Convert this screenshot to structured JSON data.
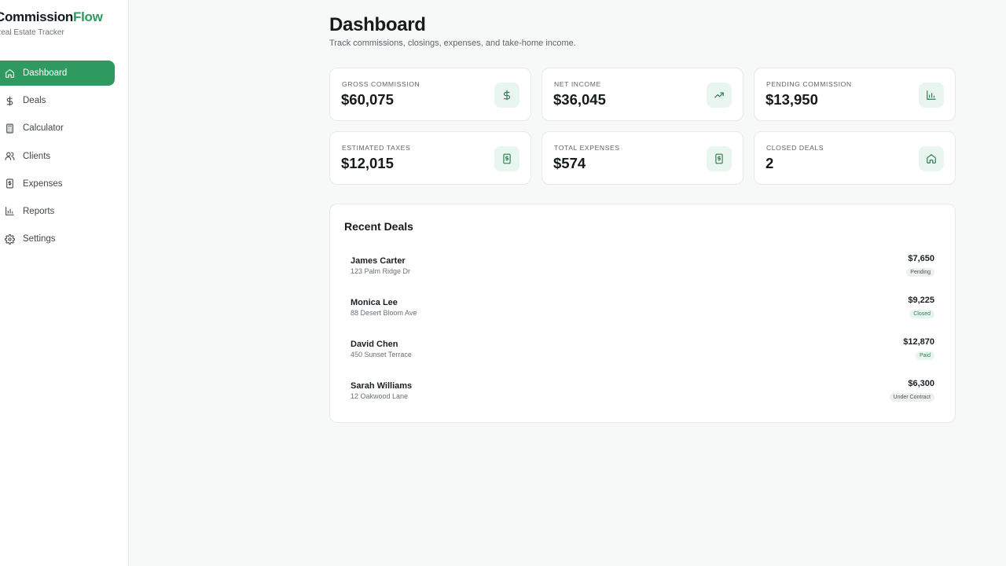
{
  "brand": {
    "name_main": "Commission",
    "name_accent": "Flow",
    "tagline": "Real Estate Tracker"
  },
  "sidebar": {
    "items": [
      {
        "label": "Dashboard",
        "icon": "home-icon",
        "active": true
      },
      {
        "label": "Deals",
        "icon": "dollar-icon"
      },
      {
        "label": "Calculator",
        "icon": "calculator-icon"
      },
      {
        "label": "Clients",
        "icon": "users-icon"
      },
      {
        "label": "Expenses",
        "icon": "receipt-icon"
      },
      {
        "label": "Reports",
        "icon": "bar-chart-icon"
      },
      {
        "label": "Settings",
        "icon": "gear-icon"
      }
    ]
  },
  "header": {
    "title": "Dashboard",
    "subtitle": "Track commissions, closings, expenses, and take-home income."
  },
  "stats": [
    {
      "label": "Gross Commission",
      "value": "$60,075",
      "icon": "dollar-icon"
    },
    {
      "label": "Net Income",
      "value": "$36,045",
      "icon": "trending-up-icon"
    },
    {
      "label": "Pending Commission",
      "value": "$13,950",
      "icon": "bar-chart-icon"
    },
    {
      "label": "Estimated Taxes",
      "value": "$12,015",
      "icon": "receipt-icon"
    },
    {
      "label": "Total Expenses",
      "value": "$574",
      "icon": "receipt-icon"
    },
    {
      "label": "Closed Deals",
      "value": "2",
      "icon": "home-icon"
    }
  ],
  "recent_deals": {
    "title": "Recent Deals",
    "rows": [
      {
        "name": "James Carter",
        "address": "123 Palm Ridge Dr",
        "amount": "$7,650",
        "status": "Pending"
      },
      {
        "name": "Monica Lee",
        "address": "88 Desert Bloom Ave",
        "amount": "$9,225",
        "status": "Closed"
      },
      {
        "name": "David Chen",
        "address": "450 Sunset Terrace",
        "amount": "$12,870",
        "status": "Paid"
      },
      {
        "name": "Sarah Williams",
        "address": "12 Oakwood Lane",
        "amount": "$6,300",
        "status": "Under Contract"
      }
    ]
  },
  "colors": {
    "accent": "#2f9a5f",
    "accent_soft": "#e9f6ef",
    "background": "#f7f8f8"
  }
}
